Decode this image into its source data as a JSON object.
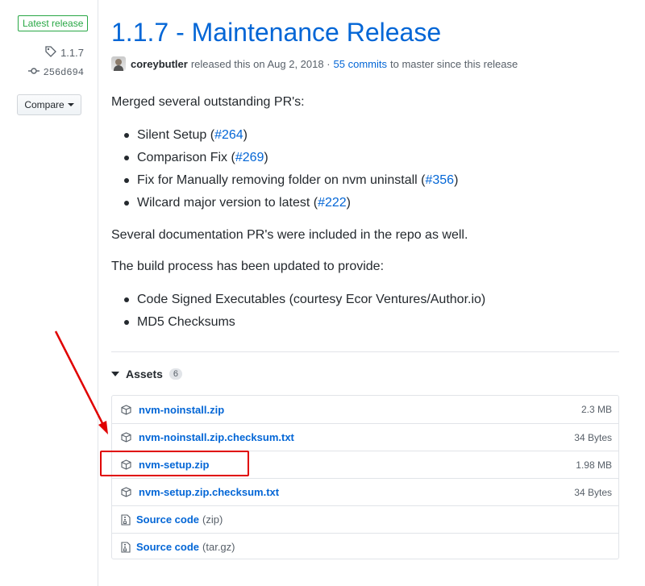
{
  "sidebar": {
    "badge": "Latest release",
    "tag": "1.1.7",
    "commit": "256d694",
    "compare_label": "Compare"
  },
  "release": {
    "title": "1.1.7 - Maintenance Release",
    "author": "coreybutler",
    "released_text": "released this on Aug 2, 2018 ·",
    "commits_link": "55 commits",
    "commits_suffix": "to master since this release"
  },
  "body": {
    "intro": "Merged several outstanding PR's:",
    "prs": [
      {
        "text": "Silent Setup (",
        "link": "#264",
        "close": ")"
      },
      {
        "text": "Comparison Fix (",
        "link": "#269",
        "close": ")"
      },
      {
        "text": "Fix for Manually removing folder on nvm uninstall (",
        "link": "#356",
        "close": ")"
      },
      {
        "text": "Wilcard major version to latest (",
        "link": "#222",
        "close": ")"
      }
    ],
    "docs_note": "Several documentation PR's were included in the repo as well.",
    "build_intro": "The build process has been updated to provide:",
    "build_items": [
      "Code Signed Executables (courtesy Ecor Ventures/Author.io)",
      "MD5 Checksums"
    ]
  },
  "assets": {
    "label": "Assets",
    "count": "6",
    "files": [
      {
        "name": "nvm-noinstall.zip",
        "size": "2.3 MB"
      },
      {
        "name": "nvm-noinstall.zip.checksum.txt",
        "size": "34 Bytes"
      },
      {
        "name": "nvm-setup.zip",
        "size": "1.98 MB"
      },
      {
        "name": "nvm-setup.zip.checksum.txt",
        "size": "34 Bytes"
      }
    ],
    "sources": [
      {
        "label": "Source code",
        "ext": "(zip)"
      },
      {
        "label": "Source code",
        "ext": "(tar.gz)"
      }
    ]
  },
  "colors": {
    "link": "#0366d6",
    "badge": "#28a745",
    "annotation": "#e00000"
  }
}
